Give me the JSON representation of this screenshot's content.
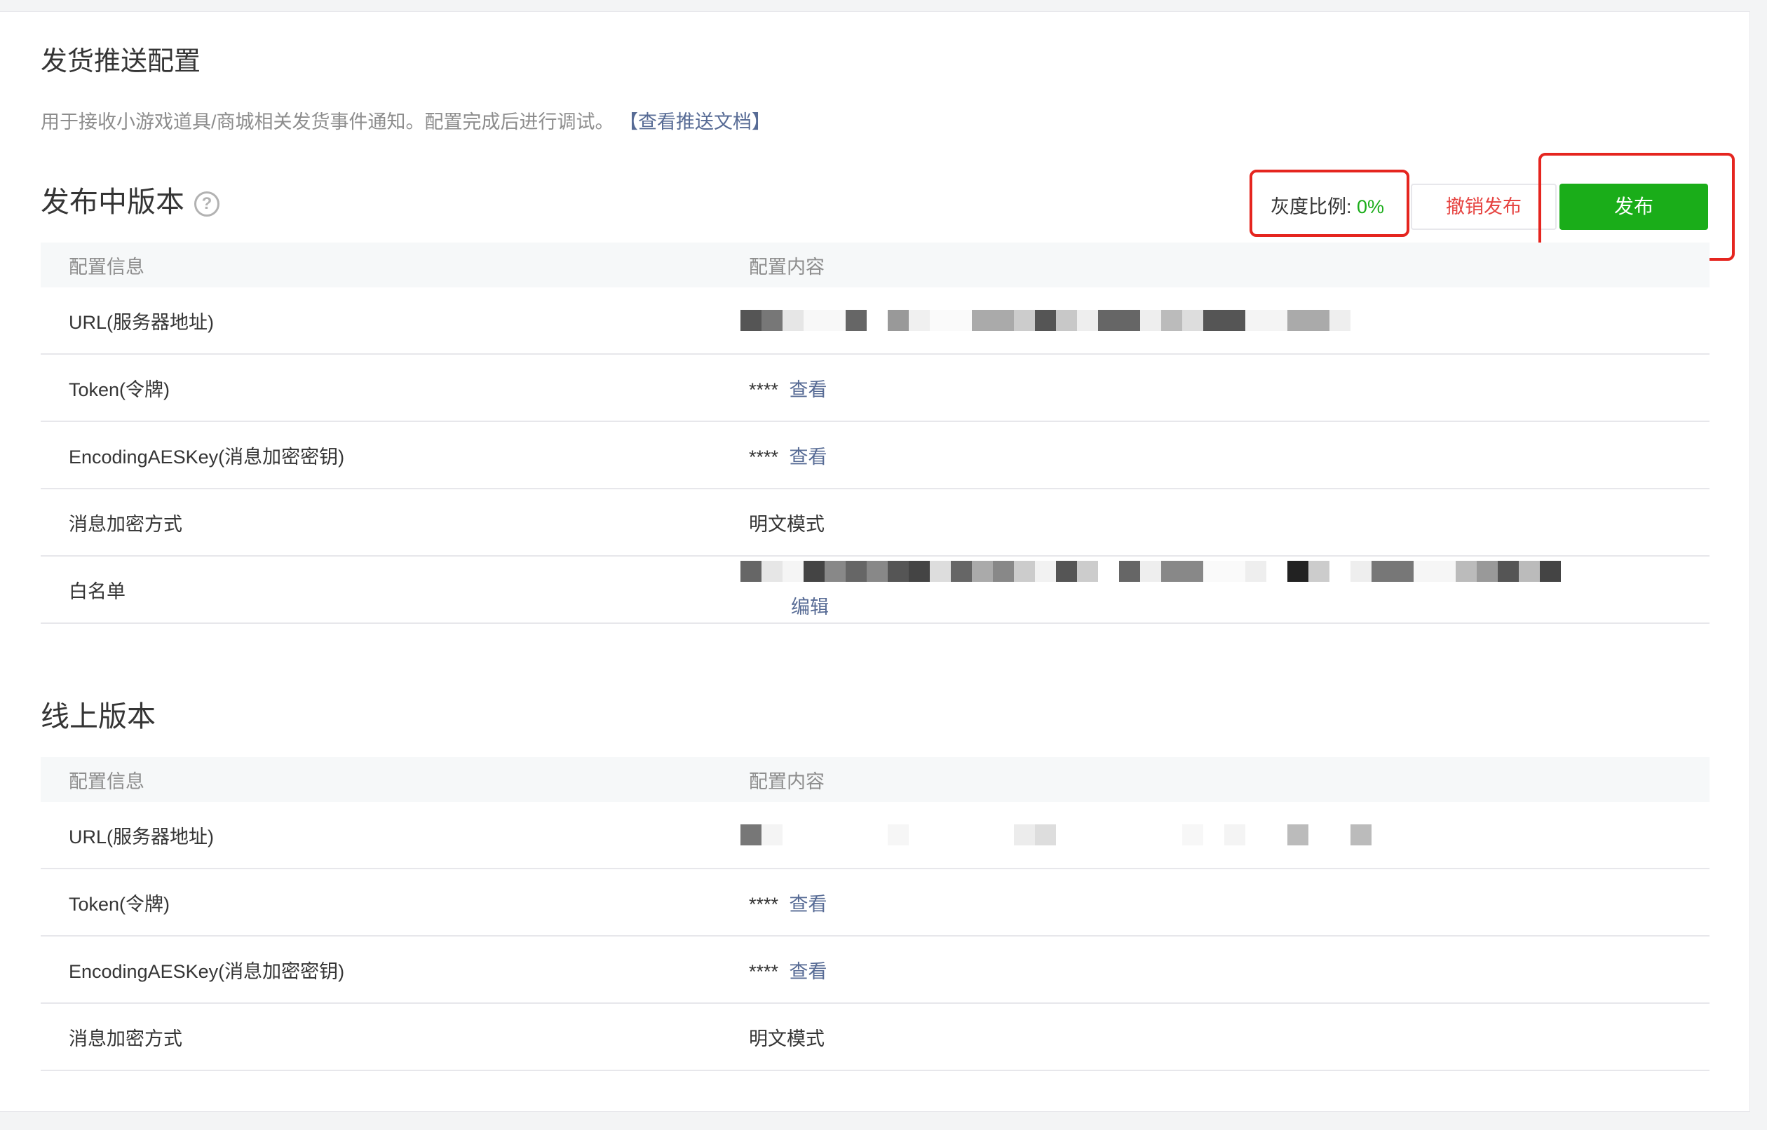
{
  "card": {
    "title": "发货推送配置",
    "description": "用于接收小游戏道具/商城相关发货事件通知。配置完成后进行调试。",
    "doc_link": "【查看推送文档】"
  },
  "publishing": {
    "title": "发布中版本",
    "help_icon": "question-circle-icon",
    "gray_label": "灰度比例:",
    "gray_value": "0%",
    "revoke_label": "撤销发布",
    "publish_label": "发布",
    "columns": [
      "配置信息",
      "配置内容"
    ],
    "rows": {
      "url_label": "URL(服务器地址)",
      "token_label": "Token(令牌)",
      "token_mask": "****",
      "token_view": "查看",
      "aes_label": "EncodingAESKey(消息加密密钥)",
      "aes_mask": "****",
      "aes_view": "查看",
      "mode_label": "消息加密方式",
      "mode_value": "明文模式",
      "whitelist_label": "白名单",
      "whitelist_edit": "编辑"
    }
  },
  "online": {
    "title": "线上版本",
    "columns": [
      "配置信息",
      "配置内容"
    ],
    "rows": {
      "url_label": "URL(服务器地址)",
      "token_label": "Token(令牌)",
      "token_mask": "****",
      "token_view": "查看",
      "aes_label": "EncodingAESKey(消息加密密钥)",
      "aes_mask": "****",
      "aes_view": "查看",
      "mode_label": "消息加密方式",
      "mode_value": "明文模式"
    }
  },
  "colors": {
    "accent_green": "#1aad19",
    "danger_red": "#e64340",
    "link_blue": "#576b95",
    "annotation_red": "#e5251f"
  }
}
